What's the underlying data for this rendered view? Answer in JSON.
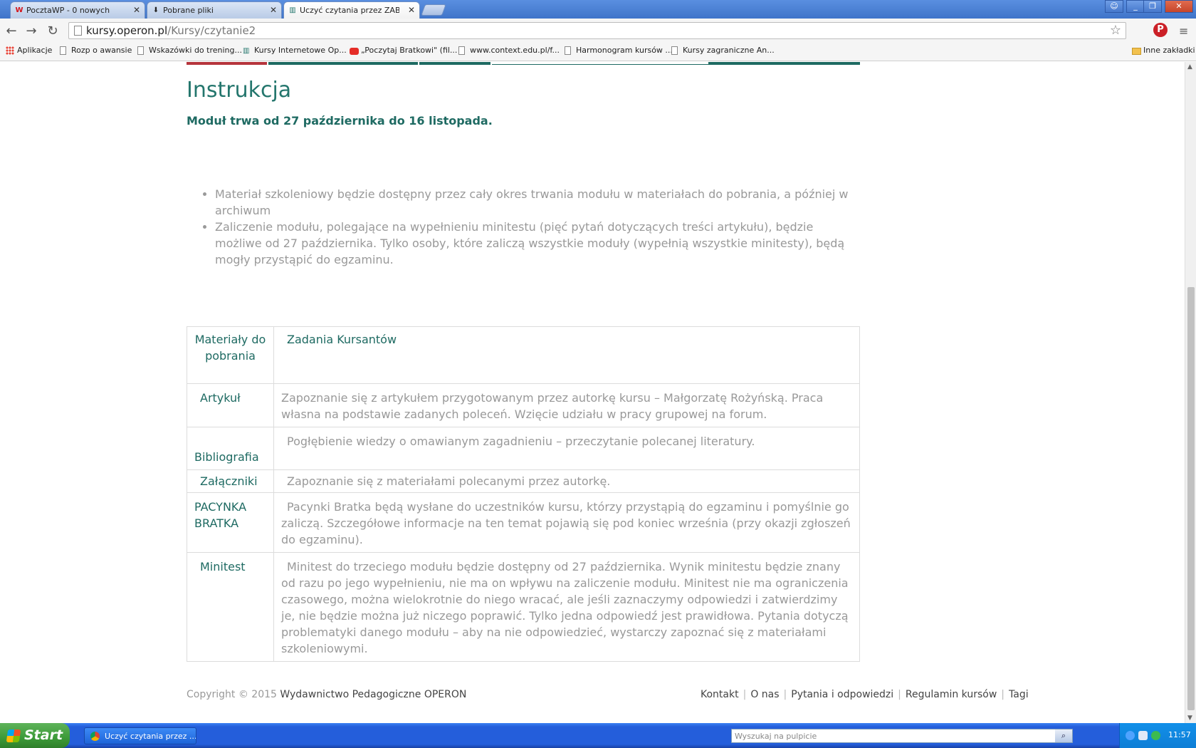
{
  "browser": {
    "tabs": [
      {
        "label": "PocztaWP - 0 nowych",
        "icon": "wp-icon"
      },
      {
        "label": "Pobrane pliki",
        "icon": "download-icon"
      },
      {
        "label": "Uczyć czytania przez ZABAW",
        "icon": "book-icon",
        "active": true
      }
    ],
    "address": {
      "domain": "kursy.operon.pl",
      "path": "/Kursy/czytanie2"
    },
    "bookmarks": [
      {
        "label": "Aplikacje",
        "icon": "apps-icon"
      },
      {
        "label": "Rozp o awansie",
        "icon": "page-icon"
      },
      {
        "label": "Wskazówki do trening...",
        "icon": "page-icon"
      },
      {
        "label": "Kursy Internetowe Op...",
        "icon": "book-icon"
      },
      {
        "label": "„Poczytaj Bratkowi\" (fil...",
        "icon": "youtube-icon"
      },
      {
        "label": "www.context.edu.pl/f...",
        "icon": "page-icon"
      },
      {
        "label": "Harmonogram kursów ...",
        "icon": "page-icon"
      },
      {
        "label": "Kursy zagraniczne An...",
        "icon": "page-icon"
      }
    ],
    "other_bookmarks": "Inne zakładki"
  },
  "page": {
    "title": "Instrukcja",
    "subtitle": "Moduł trwa od 27 października do 16 listopada.",
    "bullets": [
      "Materiał szkoleniowy będzie dostępny przez cały okres trwania modułu w materiałach do pobrania, a później w archiwum",
      "Zaliczenie modułu, polegające na wypełnieniu minitestu (pięć pytań dotyczących treści artykułu), będzie możliwe od 27 października. Tylko osoby, które zaliczą wszystkie moduły (wypełnią wszystkie minitesty), będą mogły przystąpić do egzaminu."
    ],
    "table": {
      "header": {
        "col1": "Materiały do pobrania",
        "col2": "Zadania Kursantów"
      },
      "rows": [
        {
          "label": "Artykuł",
          "text": "Zapoznanie się z artykułem przygotowanym przez autorkę kursu – Małgorzatę Rożyńską. Praca własna na podstawie zadanych poleceń. Wzięcie udziału w pracy grupowej na forum."
        },
        {
          "label": "Bibliografia",
          "text": "Pogłębienie wiedzy o omawianym zagadnieniu – przeczytanie polecanej literatury."
        },
        {
          "label": "Załączniki",
          "text": "Zapoznanie się z materiałami polecanymi przez autorkę."
        },
        {
          "label": "PACYNKA BRATKA",
          "text": "Pacynki Bratka będą wysłane do uczestników kursu, którzy przystąpią do egzaminu i pomyślnie go zaliczą. Szczegółowe informacje na ten temat pojawią się pod koniec września (przy okazji zgłoszeń do egzaminu)."
        },
        {
          "label": "Minitest",
          "text": "Minitest do trzeciego modułu będzie dostępny od 27 października. Wynik minitestu będzie znany od razu po jego wypełnieniu, nie ma on wpływu na zaliczenie modułu. Minitest nie ma ograniczenia czasowego, można wielokrotnie do niego wracać, ale jeśli zaznaczymy odpowiedzi i zatwierdzimy je, nie będzie można już niczego poprawić. Tylko jedna odpowiedź jest prawidłowa. Pytania dotyczą problematyki danego modułu – aby na nie odpowiedzieć, wystarczy zapoznać się z materiałami szkoleniowymi."
        }
      ]
    },
    "footer": {
      "copyright": "Copyright © 2015",
      "brand": "Wydawnictwo Pedagogiczne OPERON",
      "links": [
        "Kontakt",
        "O nas",
        "Pytania i odpowiedzi",
        "Regulamin kursów",
        "Tagi"
      ]
    }
  },
  "taskbar": {
    "start": "Start",
    "task": "Uczyć czytania przez ...",
    "search_placeholder": "Wyszukaj na pulpicie",
    "clock": "11:57"
  },
  "colors": {
    "accent": "#24766d",
    "muted_text": "#999999",
    "strip": [
      "#b5343c",
      "#1e6a62",
      "#1e6a62",
      "#1e6a62",
      "#ffffff",
      "#1e6a62"
    ]
  }
}
